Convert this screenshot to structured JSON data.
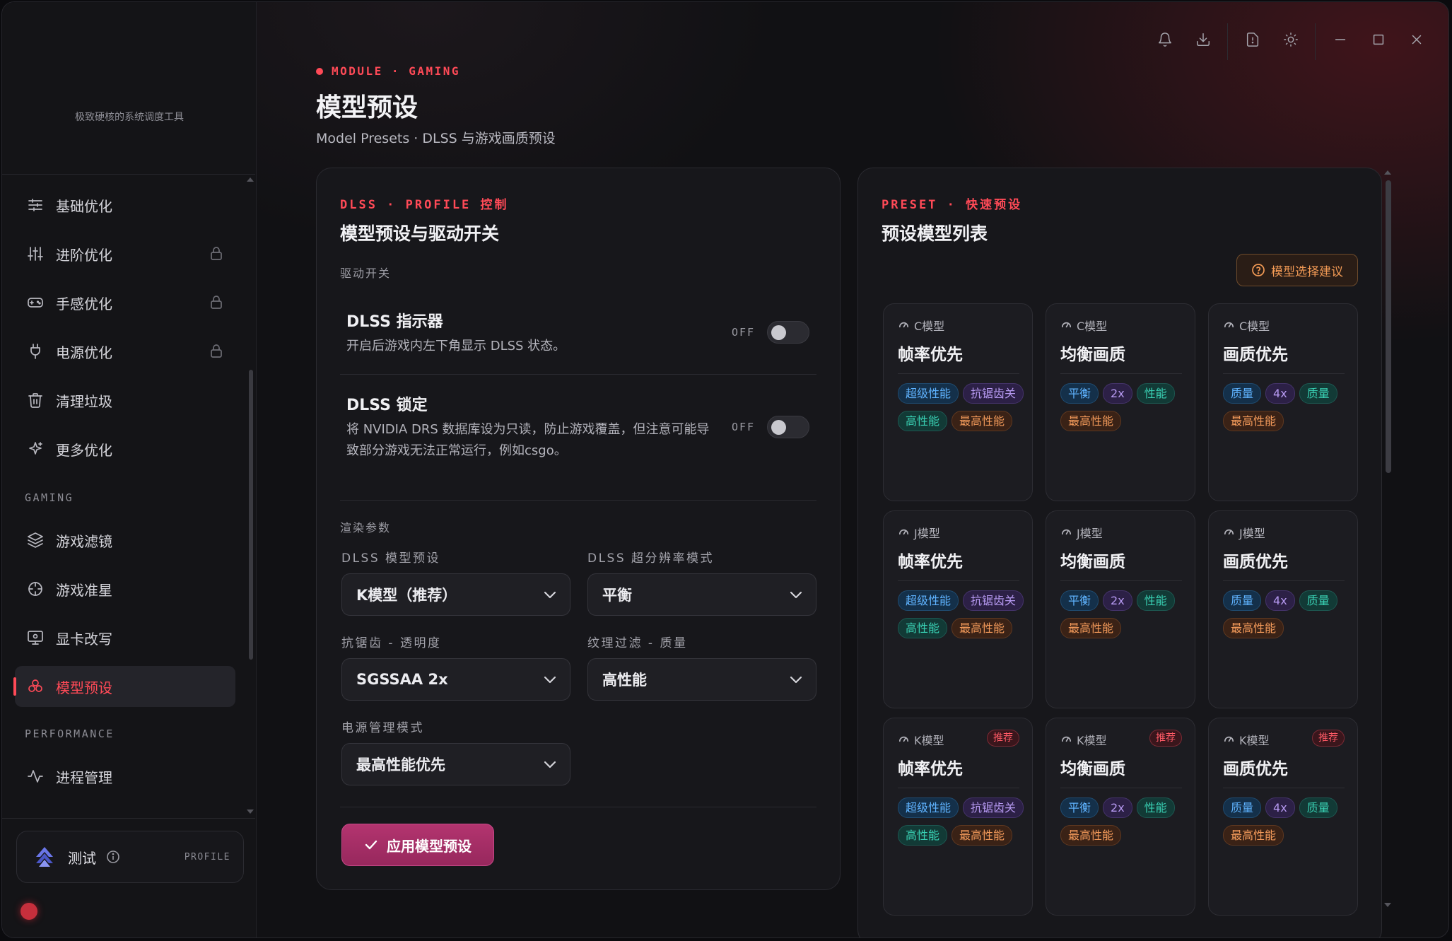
{
  "sidebar": {
    "tagline": "极致硬核的系统调度工具",
    "items": [
      {
        "label": "基础优化",
        "icon": "sliders-icon",
        "locked": false
      },
      {
        "label": "进阶优化",
        "icon": "equalizer-icon",
        "locked": true
      },
      {
        "label": "手感优化",
        "icon": "gamepad-icon",
        "locked": true
      },
      {
        "label": "电源优化",
        "icon": "plug-icon",
        "locked": true
      },
      {
        "label": "清理垃圾",
        "icon": "trash-icon",
        "locked": false
      },
      {
        "label": "更多优化",
        "icon": "sparkle-icon",
        "locked": false
      }
    ],
    "section_gaming": "GAMING",
    "gaming_items": [
      {
        "label": "游戏滤镜",
        "icon": "layers-icon"
      },
      {
        "label": "游戏准星",
        "icon": "crosshair-icon"
      },
      {
        "label": "显卡改写",
        "icon": "monitor-icon"
      },
      {
        "label": "模型预设",
        "icon": "model-icon",
        "active": true
      }
    ],
    "section_performance": "PERFORMANCE",
    "performance_items": [
      {
        "label": "进程管理",
        "icon": "activity-icon"
      }
    ],
    "profile": {
      "name": "测试",
      "tag": "PROFILE"
    }
  },
  "header": {
    "module": "MODULE · GAMING",
    "title": "模型预设",
    "subtitle": "Model Presets · DLSS 与游戏画质预设"
  },
  "left_panel": {
    "kicker": "DLSS · PROFILE 控制",
    "title": "模型预设与驱动开关",
    "driver_group": "驱动开关",
    "toggles": [
      {
        "title": "DLSS 指示器",
        "desc": "开启后游戏内左下角显示 DLSS 状态。",
        "state": "OFF"
      },
      {
        "title": "DLSS 锁定",
        "desc": "将 NVIDIA DRS 数据库设为只读，防止游戏覆盖，但注意可能导致部分游戏无法正常运行，例如csgo。",
        "state": "OFF"
      }
    ],
    "render_group": "渲染参数",
    "fields": {
      "model_preset": {
        "label": "DLSS 模型预设",
        "value": "K模型（推荐）"
      },
      "sr_mode": {
        "label": "DLSS 超分辨率模式",
        "value": "平衡"
      },
      "aa": {
        "label": "抗锯齿 - 透明度",
        "value": "SGSSAA 2x"
      },
      "tex": {
        "label": "纹理过滤 - 质量",
        "value": "高性能"
      },
      "power": {
        "label": "电源管理模式",
        "value": "最高性能优先"
      }
    },
    "apply_label": "应用模型预设"
  },
  "right_panel": {
    "kicker": "PRESET · 快速预设",
    "title": "预设模型列表",
    "advice_label": "模型选择建议",
    "recommend_label": "推荐",
    "cards": [
      {
        "model": "C模型",
        "title": "帧率优先",
        "tags": [
          [
            "超级性能",
            "blue"
          ],
          [
            "抗锯齿关",
            "purple"
          ],
          [
            "高性能",
            "teal"
          ],
          [
            "最高性能",
            "orange"
          ]
        ]
      },
      {
        "model": "C模型",
        "title": "均衡画质",
        "tags": [
          [
            "平衡",
            "blue"
          ],
          [
            "2x",
            "purple"
          ],
          [
            "性能",
            "teal"
          ],
          [
            "最高性能",
            "orange"
          ]
        ]
      },
      {
        "model": "C模型",
        "title": "画质优先",
        "tags": [
          [
            "质量",
            "blue"
          ],
          [
            "4x",
            "purple"
          ],
          [
            "质量",
            "teal"
          ],
          [
            "最高性能",
            "orange"
          ]
        ]
      },
      {
        "model": "J模型",
        "title": "帧率优先",
        "tags": [
          [
            "超级性能",
            "blue"
          ],
          [
            "抗锯齿关",
            "purple"
          ],
          [
            "高性能",
            "teal"
          ],
          [
            "最高性能",
            "orange"
          ]
        ]
      },
      {
        "model": "J模型",
        "title": "均衡画质",
        "tags": [
          [
            "平衡",
            "blue"
          ],
          [
            "2x",
            "purple"
          ],
          [
            "性能",
            "teal"
          ],
          [
            "最高性能",
            "orange"
          ]
        ]
      },
      {
        "model": "J模型",
        "title": "画质优先",
        "tags": [
          [
            "质量",
            "blue"
          ],
          [
            "4x",
            "purple"
          ],
          [
            "质量",
            "teal"
          ],
          [
            "最高性能",
            "orange"
          ]
        ]
      },
      {
        "model": "K模型",
        "title": "帧率优先",
        "recommended": true,
        "tags": [
          [
            "超级性能",
            "blue"
          ],
          [
            "抗锯齿关",
            "purple"
          ],
          [
            "高性能",
            "teal"
          ],
          [
            "最高性能",
            "orange"
          ]
        ]
      },
      {
        "model": "K模型",
        "title": "均衡画质",
        "recommended": true,
        "tags": [
          [
            "平衡",
            "blue"
          ],
          [
            "2x",
            "purple"
          ],
          [
            "性能",
            "teal"
          ],
          [
            "最高性能",
            "orange"
          ]
        ]
      },
      {
        "model": "K模型",
        "title": "画质优先",
        "recommended": true,
        "tags": [
          [
            "质量",
            "blue"
          ],
          [
            "4x",
            "purple"
          ],
          [
            "质量",
            "teal"
          ],
          [
            "最高性能",
            "orange"
          ]
        ]
      }
    ]
  },
  "colors": {
    "accent": "#ff4a57",
    "apply": "#a8306a",
    "advice": "#f29a55"
  }
}
